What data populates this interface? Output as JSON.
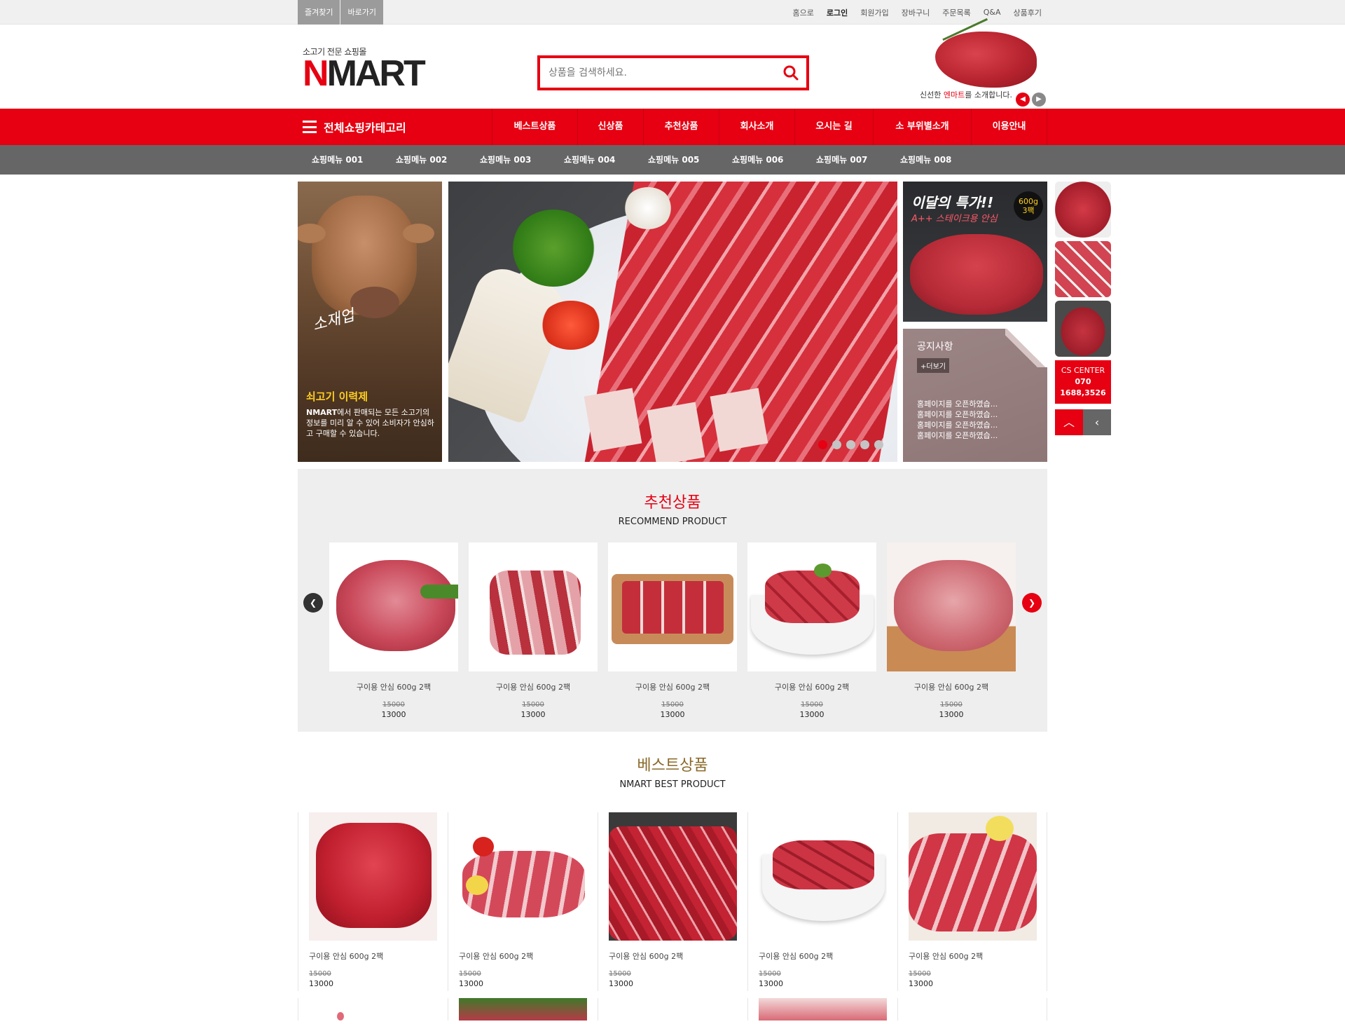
{
  "util": {
    "left": [
      "즐겨찾기",
      "바로가기"
    ],
    "right": [
      "홈으로",
      "로그인",
      "회원가입",
      "장바구니",
      "주문목록",
      "Q&A",
      "상품후기"
    ]
  },
  "header": {
    "tagline": "소고기 전문 쇼핑몰",
    "brand_n": "N",
    "brand_rest": "MART",
    "search_placeholder": "상품을 검색하세요.",
    "promo_pre": "신선한 ",
    "promo_em": "엔마트",
    "promo_post": "를 소개합니다."
  },
  "gnb": {
    "all_label": "전체쇼핑카테고리",
    "items": [
      "베스트상품",
      "신상품",
      "추천상품",
      "회사소개",
      "오시는 길",
      "소 부위별소개",
      "이용안내"
    ]
  },
  "snb": [
    "쇼핑메뉴 001",
    "쇼핑메뉴 002",
    "쇼핑메뉴 003",
    "쇼핑메뉴 004",
    "쇼핑메뉴 005",
    "쇼핑메뉴 006",
    "쇼핑메뉴 007",
    "쇼핑메뉴 008"
  ],
  "visual": {
    "left_script": "소재업",
    "left_title": "쇠고기 이력제",
    "left_brand": "NMART",
    "left_desc": "에서 판매되는 모든 소고기의 정보를 미리 알 수 있어 소비자가 안심하고 구매할 수 있습니다.",
    "slide_dots": 5,
    "slide_active": 0,
    "special_t1": "이달의 특가!!",
    "special_t2": "A++ 스테이크용 안심",
    "special_badge_1": "600g",
    "special_badge_2": "3팩",
    "notice_title": "공지사항",
    "notice_more": "+더보기",
    "notice_items": [
      "홈페이지를 오픈하였습...",
      "홈페이지를 오픈하였습...",
      "홈페이지를 오픈하였습...",
      "홈페이지를 오픈하였습..."
    ],
    "cs_label": "CS CENTER",
    "cs_line1": "070",
    "cs_line2": "1688,3526"
  },
  "recommend": {
    "title_ko": "추천상품",
    "title_en": "RECOMMEND PRODUCT",
    "items": [
      {
        "name": "구이용 안심 600g 2팩",
        "old_price": "15000",
        "price": "13000"
      },
      {
        "name": "구이용 안심 600g 2팩",
        "old_price": "15000",
        "price": "13000"
      },
      {
        "name": "구이용 안심 600g 2팩",
        "old_price": "15000",
        "price": "13000"
      },
      {
        "name": "구이용 안심 600g 2팩",
        "old_price": "15000",
        "price": "13000"
      },
      {
        "name": "구이용 안심 600g 2팩",
        "old_price": "15000",
        "price": "13000"
      }
    ]
  },
  "best": {
    "title_ko": "베스트상품",
    "title_en": "NMART BEST PRODUCT",
    "items": [
      {
        "name": "구이용 안심 600g 2팩",
        "old_price": "15000",
        "price": "13000"
      },
      {
        "name": "구이용 안심 600g 2팩",
        "old_price": "15000",
        "price": "13000"
      },
      {
        "name": "구이용 안심 600g 2팩",
        "old_price": "15000",
        "price": "13000"
      },
      {
        "name": "구이용 안심 600g 2팩",
        "old_price": "15000",
        "price": "13000"
      },
      {
        "name": "구이용 안심 600g 2팩",
        "old_price": "15000",
        "price": "13000"
      }
    ]
  },
  "colors": {
    "accent": "#e60012",
    "subnav": "#666666",
    "section_bg": "#eeeeee"
  }
}
